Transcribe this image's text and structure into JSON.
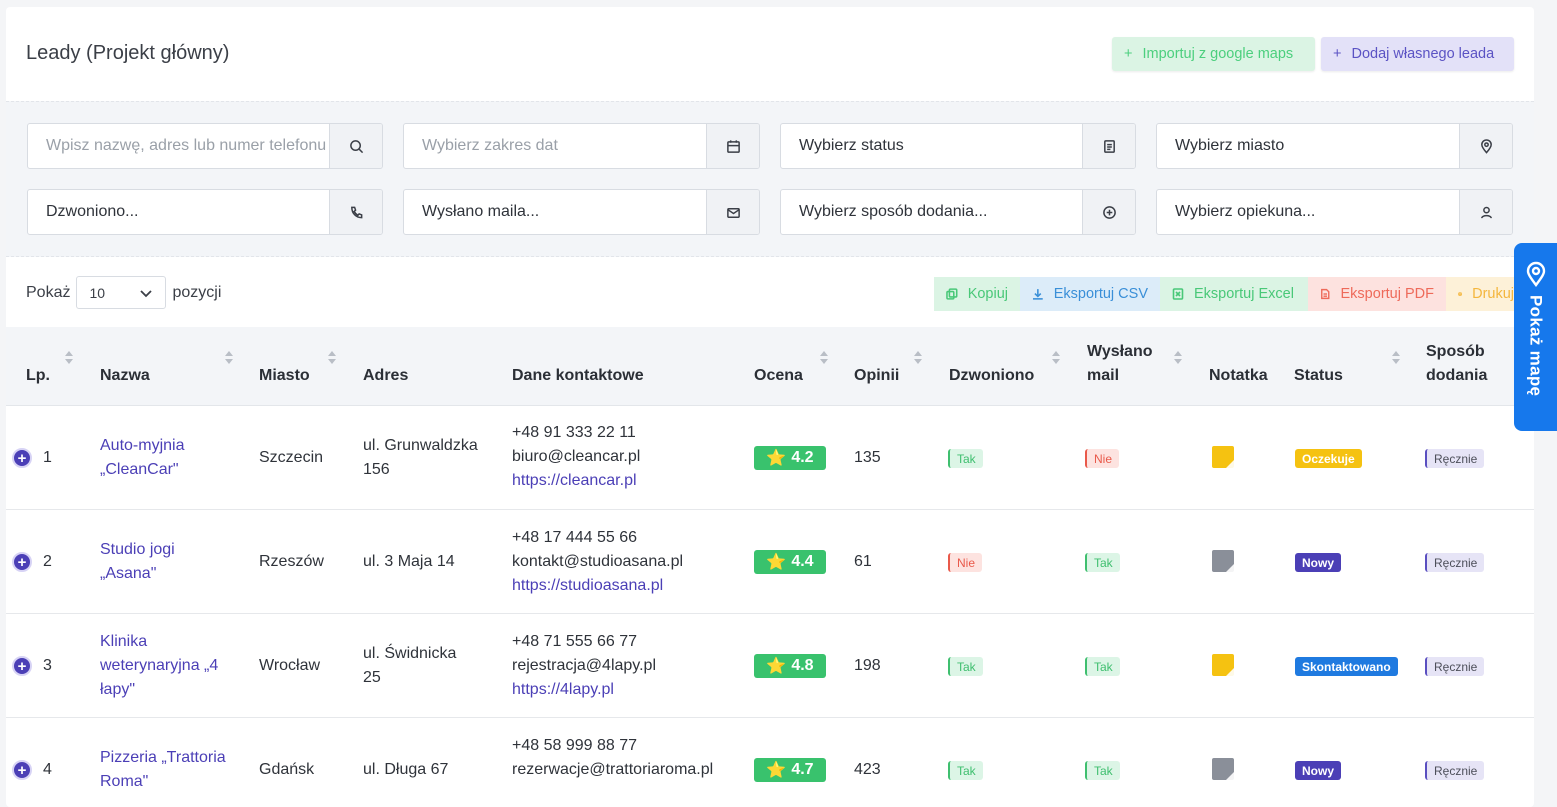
{
  "header": {
    "title": "Leady (Projekt główny)",
    "import_button": "Importuj z google maps",
    "add_button": "Dodaj własnego leada"
  },
  "filters": {
    "search_placeholder": "Wpisz nazwę, adres lub numer telefonu",
    "date_placeholder": "Wybierz zakres dat",
    "status": "Wybierz status",
    "city": "Wybierz miasto",
    "called": "Dzwoniono...",
    "mailed": "Wysłano maila...",
    "added_by": "Wybierz sposób dodania...",
    "owner": "Wybierz opiekuna..."
  },
  "pagination": {
    "show_label": "Pokaż",
    "page_size": "10",
    "items_label": "pozycji"
  },
  "export": {
    "copy": "Kopiuj",
    "csv": "Eksportuj CSV",
    "excel": "Eksportuj Excel",
    "pdf": "Eksportuj PDF",
    "print": "Drukuj"
  },
  "table": {
    "columns": {
      "lp": "Lp.",
      "name": "Nazwa",
      "city": "Miasto",
      "address": "Adres",
      "contact": "Dane kontaktowe",
      "rating": "Ocena",
      "reviews": "Opinii",
      "called": "Dzwoniono",
      "mail_line1": "Wysłano",
      "mail_line2": "mail",
      "note": "Notatka",
      "status": "Status",
      "method_line1": "Sposób",
      "method_line2": "dodania"
    },
    "rows": [
      {
        "lp": "1",
        "name_line1": "Auto-myjnia",
        "name_line2": "„CleanCar\"",
        "name_line3": "",
        "city": "Szczecin",
        "addr_line1": "ul. Grunwaldzka",
        "addr_line2": "156",
        "phone": "+48 91 333 22 11",
        "email": "biuro@cleancar.pl",
        "url": "https://cleancar.pl",
        "rating": "4.2",
        "reviews": "135",
        "called": "Tak",
        "mailed": "Nie",
        "note_color": "#f5c211",
        "status": "Oczekuje",
        "status_color": "#f5c211",
        "method": "Ręcznie"
      },
      {
        "lp": "2",
        "name_line1": "Studio jogi",
        "name_line2": "„Asana\"",
        "name_line3": "",
        "city": "Rzeszów",
        "addr_line1": "ul. 3 Maja 14",
        "addr_line2": "",
        "phone": "+48 17 444 55 66",
        "email": "kontakt@studioasana.pl",
        "url": "https://studioasana.pl",
        "rating": "4.4",
        "reviews": "61",
        "called": "Nie",
        "mailed": "Tak",
        "note_color": "#8a8f99",
        "status": "Nowy",
        "status_color": "#4b3fb6",
        "method": "Ręcznie"
      },
      {
        "lp": "3",
        "name_line1": "Klinika",
        "name_line2": "weterynaryjna „4",
        "name_line3": "łapy\"",
        "city": "Wrocław",
        "addr_line1": "ul. Świdnicka",
        "addr_line2": "25",
        "phone": "+48 71 555 66 77",
        "email": "rejestracja@4lapy.pl",
        "url": "https://4lapy.pl",
        "rating": "4.8",
        "reviews": "198",
        "called": "Tak",
        "mailed": "Tak",
        "note_color": "#f5c211",
        "status": "Skontaktowano",
        "status_color": "#1f7ae0",
        "method": "Ręcznie"
      },
      {
        "lp": "4",
        "name_line1": "Pizzeria „Trattoria",
        "name_line2": "Roma\"",
        "name_line3": "",
        "city": "Gdańsk",
        "addr_line1": "ul. Długa 67",
        "addr_line2": "",
        "phone": "+48 58 999 88 77",
        "email": "rezerwacje@trattoriaroma.pl",
        "url": "",
        "rating": "4.7",
        "reviews": "423",
        "called": "Tak",
        "mailed": "Tak",
        "note_color": "#8a8f99",
        "status": "Nowy",
        "status_color": "#4b3fb6",
        "method": "Ręcznie"
      }
    ]
  },
  "map_tab": {
    "label": "Pokaż mapę"
  },
  "colors": {
    "accent": "#4b3fb6",
    "rating_green": "#39c26d",
    "map_blue": "#1678ec"
  }
}
